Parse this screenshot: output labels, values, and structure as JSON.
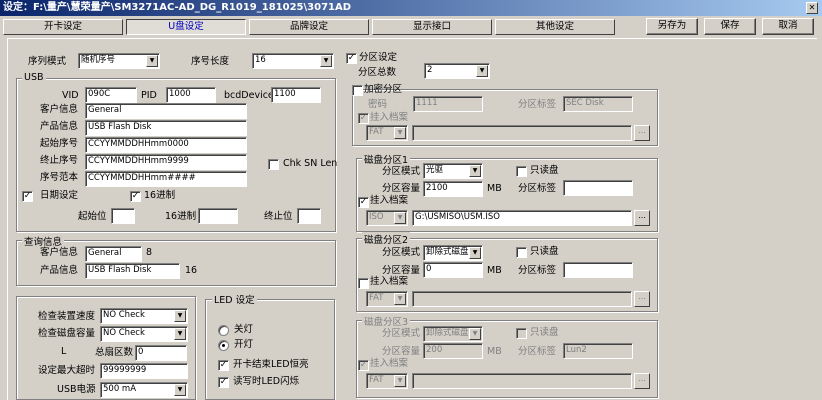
{
  "window": {
    "title": "设定：F:\\量产\\慧荣量产\\SM3271AC-AD_DG_R1019_181025\\3071AD"
  },
  "tabs": [
    "开卡设定",
    "U盘设定",
    "品牌设定",
    "显示接口",
    "其他设定"
  ],
  "buttons": {
    "save_as": "另存为",
    "save": "保存",
    "cancel": "取消"
  },
  "left": {
    "serial_mode_label": "序列模式",
    "serial_mode_value": "随机序号",
    "serial_len_label": "序号长度",
    "serial_len_value": "16",
    "usb_group": "USB",
    "vid_label": "VID",
    "vid_value": "090C",
    "pid_label": "PID",
    "pid_value": "1000",
    "bcd_label": "bcdDevice",
    "bcd_value": "1100",
    "customer_label": "客户信息",
    "customer_value": "General",
    "product_label": "产品信息",
    "product_value": "USB Flash Disk",
    "start_sn_label": "起始序号",
    "start_sn_value": "CCYYMMDDHHmm0000",
    "end_sn_label": "终止序号",
    "end_sn_value": "CCYYMMDDHHmm9999",
    "sn_sample_label": "序号范本",
    "sn_sample_value": "CCYYMMDDHHmm####",
    "chk_sn_len": "Chk SN Len",
    "date_setting": "日期设定",
    "hex16": "16进制",
    "start_pos": "起始位",
    "hex16_2": "16进制",
    "end_pos": "终止位",
    "query_group": "查询信息",
    "q_customer_label": "客户信息",
    "q_customer_value": "General",
    "q_customer_len": "8",
    "q_product_label": "产品信息",
    "q_product_value": "USB Flash Disk",
    "q_product_len": "16",
    "check_speed_label": "检查装置速度",
    "check_speed_value": "NO Check",
    "check_cap_label": "检查磁盘容量",
    "check_cap_value": "NO Check",
    "l_label": "L",
    "total_sectors_label": "总扇区数",
    "total_sectors_value": "0",
    "max_timeout_label": "设定最大超时",
    "max_timeout_value": "99999999",
    "usb_power_label": "USB电源",
    "usb_power_value": "500 mA",
    "led_group": "LED 设定",
    "led_off": "关灯",
    "led_on": "开灯",
    "led_card_done": "开卡结束LED恒亮",
    "led_rw_blink": "读写时LED闪烁"
  },
  "right": {
    "partition_setting": "分区设定",
    "partition_count_label": "分区总数",
    "partition_count_value": "2",
    "encrypt_group": "加密分区",
    "password_label": "密码",
    "password_value": "1111",
    "enc_label_label": "分区标签",
    "enc_label_value": "SEC Disk",
    "enc_load_file": "挂入档案",
    "enc_file_type": "FAT",
    "disk1_group": "磁盘分区1",
    "d1_mode_label": "分区模式",
    "d1_mode_value": "光驱",
    "d1_readonly": "只读盘",
    "d1_cap_label": "分区容量",
    "d1_cap_value": "2100",
    "d1_cap_unit": "MB",
    "d1_label_label": "分区标签",
    "d1_load_file": "挂入档案",
    "d1_file_type": "ISO",
    "d1_file_path": "G:\\USMISO\\USM.ISO",
    "disk2_group": "磁盘分区2",
    "d2_mode_label": "分区模式",
    "d2_mode_value": "卸除式磁盘",
    "d2_readonly": "只读盘",
    "d2_cap_label": "分区容量",
    "d2_cap_value": "0",
    "d2_cap_unit": "MB",
    "d2_label_label": "分区标签",
    "d2_load_file": "挂入档案",
    "d2_file_type": "FAT",
    "disk3_group": "磁盘分区3",
    "d3_mode_label": "分区模式",
    "d3_mode_value": "卸除式磁盘",
    "d3_readonly": "只读盘",
    "d3_cap_label": "分区容量",
    "d3_cap_value": "200",
    "d3_cap_unit": "MB",
    "d3_label_label": "分区标签",
    "d3_label_value": "Lun2",
    "d3_load_file": "挂入档案",
    "d3_file_type": "FAT"
  },
  "glyphs": {
    "check": "✓",
    "arrow": "▼",
    "dots": "...",
    "close": "✕"
  }
}
